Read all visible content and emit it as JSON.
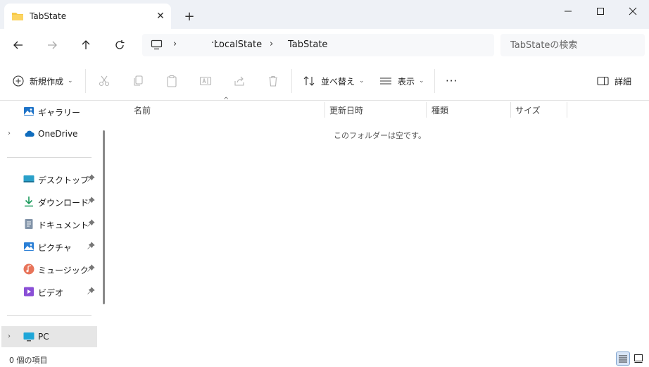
{
  "window": {
    "tab_title": "TabState",
    "tab_close": "✕",
    "new_tab": "+"
  },
  "address": {
    "ellipsis": "···",
    "sep": "›",
    "crumbs": [
      "LocalState",
      "TabState"
    ]
  },
  "search": {
    "placeholder": "TabStateの検索"
  },
  "commands": {
    "new_label": "新規作成",
    "sort_label": "並べ替え",
    "view_label": "表示",
    "more_label": "···",
    "details_label": "詳細",
    "chevron": "⌄"
  },
  "sidebar": {
    "items": [
      {
        "label": "ギャラリー"
      },
      {
        "label": "OneDrive"
      },
      {
        "label": "デスクトップ"
      },
      {
        "label": "ダウンロード"
      },
      {
        "label": "ドキュメント"
      },
      {
        "label": "ピクチャ"
      },
      {
        "label": "ミュージック"
      },
      {
        "label": "ビデオ"
      },
      {
        "label": "PC"
      }
    ],
    "chevron": "›"
  },
  "columns": {
    "name": "名前",
    "modified": "更新日時",
    "type": "種類",
    "size": "サイズ",
    "sort_arrow": "^"
  },
  "empty_message": "このフォルダーは空です。",
  "status": {
    "item_count": "0 個の項目"
  },
  "colors": {
    "titlebar_bg": "#eef1f6",
    "folder_yellow": "#f7c948",
    "onedrive_blue": "#0f6cbd",
    "selected_bg": "#e6e6e6"
  }
}
